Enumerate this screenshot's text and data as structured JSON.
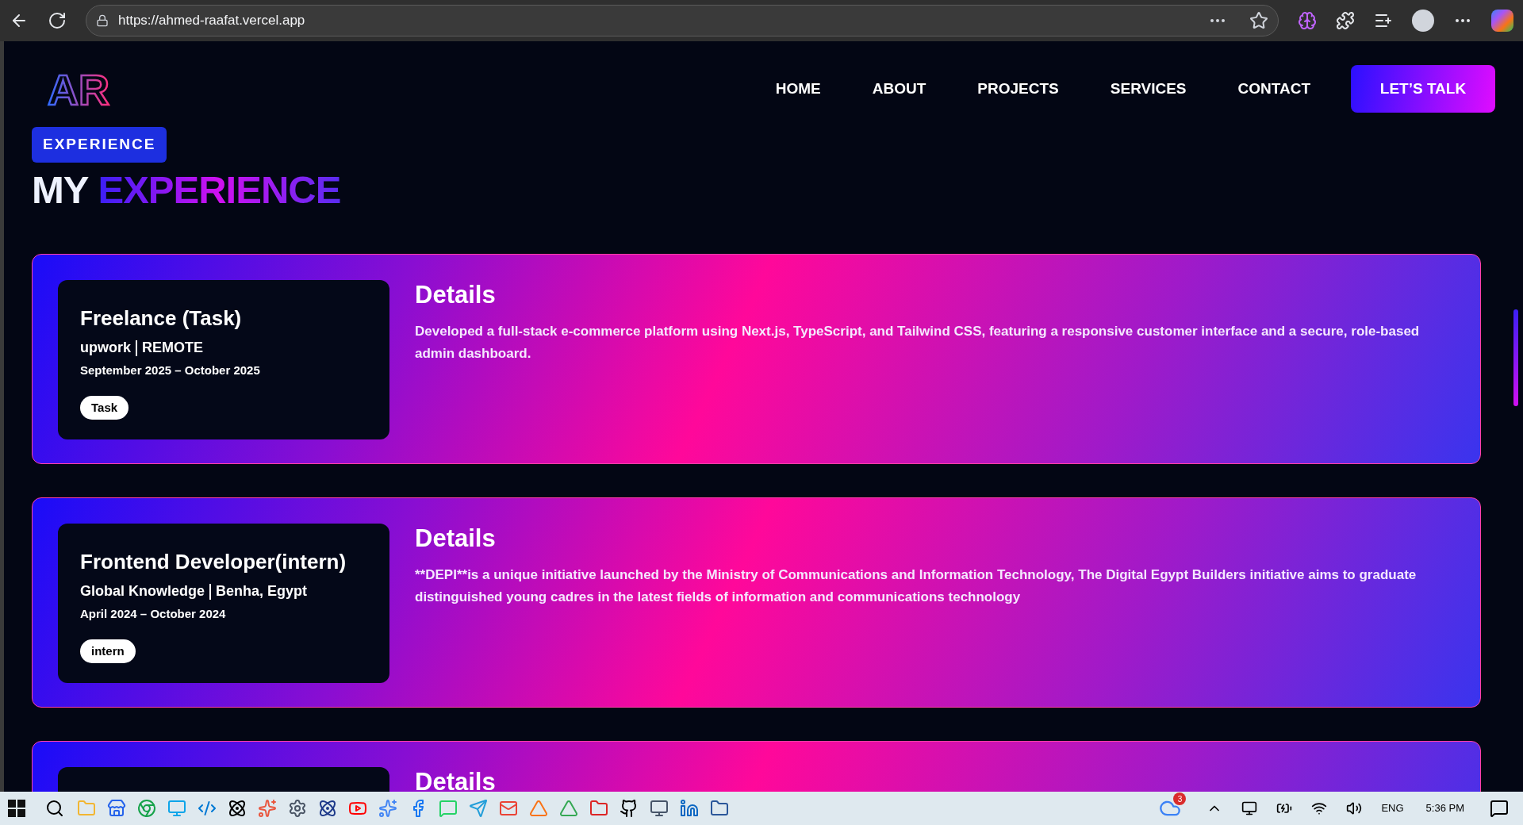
{
  "browser": {
    "url": "https://ahmed-raafat.vercel.app"
  },
  "nav": {
    "logo": "AR",
    "links": [
      "HOME",
      "ABOUT",
      "PROJECTS",
      "SERVICES",
      "CONTACT"
    ],
    "cta": "LET’S TALK"
  },
  "section": {
    "badge": "EXPERIENCE",
    "title_plain": "MY",
    "title_accent": "EXPERIENCE"
  },
  "experiences": [
    {
      "title": "Freelance (Task)",
      "company": "upwork",
      "location": "REMOTE",
      "dates": "September 2025 – October 2025",
      "tag": "Task",
      "details_title": "Details",
      "details": "Developed a full-stack e-commerce platform using Next.js, TypeScript, and Tailwind CSS, featuring a responsive customer interface and a secure, role-based admin dashboard."
    },
    {
      "title": "Frontend Developer(intern)",
      "company": "Global Knowledge",
      "location": "Benha, Egypt",
      "dates": "April 2024 – October 2024",
      "tag": "intern",
      "details_title": "Details",
      "details": "**DEPI**is a unique initiative launched by the Ministry of Communications and Information Technology, The Digital Egypt Builders initiative aims to graduate distinguished young cadres in the latest fields of information and communications technology"
    },
    {
      "details_title": "Details"
    }
  ],
  "taskbar": {
    "weather_badge": "3",
    "language": "ENG",
    "time": "5:36 PM"
  }
}
